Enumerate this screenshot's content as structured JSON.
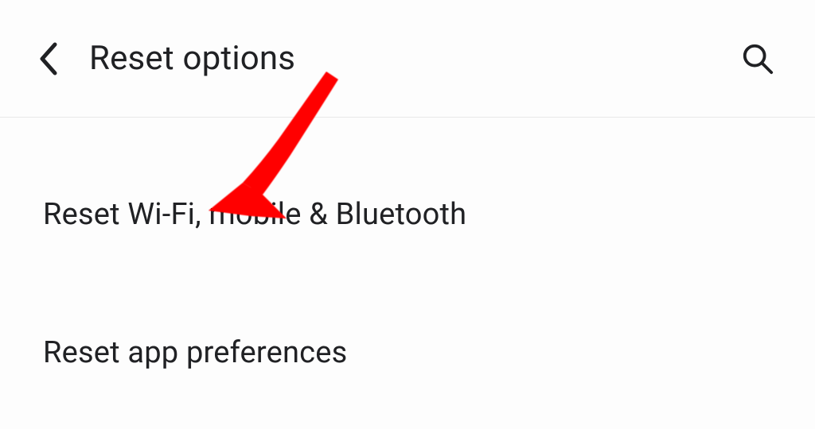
{
  "header": {
    "title": "Reset options"
  },
  "options": [
    {
      "label": "Reset Wi-Fi, mobile & Bluetooth"
    },
    {
      "label": "Reset app preferences"
    }
  ],
  "annotation": {
    "color": "#ff0000"
  }
}
